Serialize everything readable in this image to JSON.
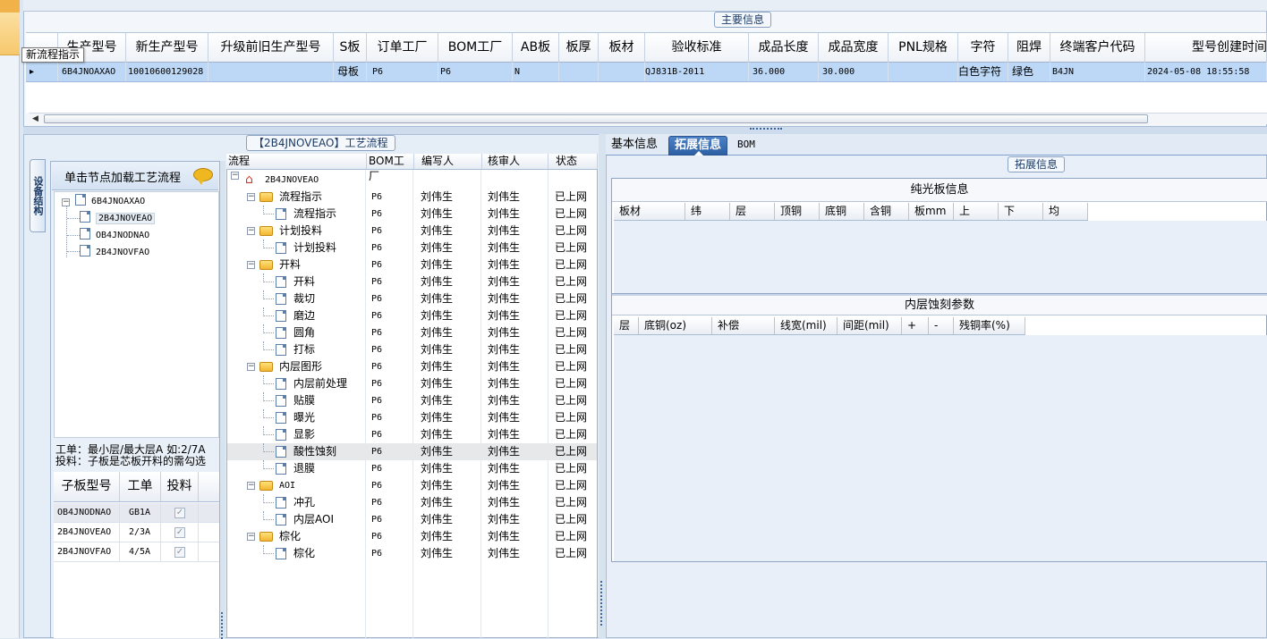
{
  "main": {
    "caption": "主要信息",
    "tooltip": "新流程指示",
    "columns": [
      "生产型号",
      "新生产型号",
      "升级前旧生产型号",
      "S板",
      "订单工厂",
      "BOM工厂",
      "AB板",
      "板厚",
      "板材",
      "验收标准",
      "成品长度",
      "成品宽度",
      "PNL规格",
      "字符",
      "阻焊",
      "终端客户代码",
      "型号创建时间"
    ],
    "row": {
      "indicator": "▸",
      "model": "6B4JNOAXAO",
      "new_model": "10010600129028",
      "old_model": "",
      "s_board": "母板",
      "order_factory": "P6",
      "bom_factory": "P6",
      "ab_board": "N",
      "thickness": "",
      "material": "",
      "standard": "QJ831B-2011",
      "length": "36.000",
      "width": "30.000",
      "pnl": "",
      "character": "白色字符",
      "solder_mask": "绿色",
      "customer_code": "B4JN",
      "created": "2024-05-08 18:55:58"
    }
  },
  "flow": {
    "caption": "【2B4JNOVEAO】工艺流程",
    "struct_tab": "设备结构",
    "struct_hint": "单击节点加载工艺流程",
    "struct_tree": {
      "root": "6B4JNOAXAO",
      "children": [
        "2B4JNOVEAO",
        "OB4JNODNAO",
        "2B4JNOVFAO"
      ]
    },
    "note_line1": "工单：最小层/最大层A 如:2/7A",
    "note_line2": "投料：子板是芯板开料的需勾选",
    "sub_columns": [
      "子板型号",
      "工单",
      "投料"
    ],
    "sub_rows": [
      {
        "model": "OB4JNODNAO",
        "order": "GB1A",
        "check": "✓"
      },
      {
        "model": "2B4JNOVEAO",
        "order": "2/3A",
        "check": "✓"
      },
      {
        "model": "2B4JNOVFAO",
        "order": "4/5A",
        "check": "✓"
      }
    ],
    "columns": [
      "流程",
      "BOM工厂",
      "编写人",
      "核审人",
      "状态"
    ],
    "root_node": "2B4JNOVEAO",
    "rows": [
      {
        "name": "流程指示",
        "type": "folder",
        "factory": "P6",
        "writer": "刘伟生",
        "reviewer": "刘伟生",
        "status": "已上网"
      },
      {
        "name": "流程指示",
        "type": "doc",
        "factory": "P6",
        "writer": "刘伟生",
        "reviewer": "刘伟生",
        "status": "已上网"
      },
      {
        "name": "计划投料",
        "type": "folder",
        "factory": "P6",
        "writer": "刘伟生",
        "reviewer": "刘伟生",
        "status": "已上网"
      },
      {
        "name": "计划投料",
        "type": "doc",
        "factory": "P6",
        "writer": "刘伟生",
        "reviewer": "刘伟生",
        "status": "已上网"
      },
      {
        "name": "开料",
        "type": "folder",
        "factory": "P6",
        "writer": "刘伟生",
        "reviewer": "刘伟生",
        "status": "已上网"
      },
      {
        "name": "开料",
        "type": "doc",
        "factory": "P6",
        "writer": "刘伟生",
        "reviewer": "刘伟生",
        "status": "已上网"
      },
      {
        "name": "裁切",
        "type": "doc",
        "factory": "P6",
        "writer": "刘伟生",
        "reviewer": "刘伟生",
        "status": "已上网"
      },
      {
        "name": "磨边",
        "type": "doc",
        "factory": "P6",
        "writer": "刘伟生",
        "reviewer": "刘伟生",
        "status": "已上网"
      },
      {
        "name": "圆角",
        "type": "doc",
        "factory": "P6",
        "writer": "刘伟生",
        "reviewer": "刘伟生",
        "status": "已上网"
      },
      {
        "name": "打标",
        "type": "doc",
        "factory": "P6",
        "writer": "刘伟生",
        "reviewer": "刘伟生",
        "status": "已上网"
      },
      {
        "name": "内层图形",
        "type": "folder",
        "factory": "P6",
        "writer": "刘伟生",
        "reviewer": "刘伟生",
        "status": "已上网"
      },
      {
        "name": "内层前处理",
        "type": "doc",
        "factory": "P6",
        "writer": "刘伟生",
        "reviewer": "刘伟生",
        "status": "已上网"
      },
      {
        "name": "贴膜",
        "type": "doc",
        "factory": "P6",
        "writer": "刘伟生",
        "reviewer": "刘伟生",
        "status": "已上网"
      },
      {
        "name": "曝光",
        "type": "doc",
        "factory": "P6",
        "writer": "刘伟生",
        "reviewer": "刘伟生",
        "status": "已上网"
      },
      {
        "name": "显影",
        "type": "doc",
        "factory": "P6",
        "writer": "刘伟生",
        "reviewer": "刘伟生",
        "status": "已上网"
      },
      {
        "name": "酸性蚀刻",
        "type": "doc",
        "factory": "P6",
        "writer": "刘伟生",
        "reviewer": "刘伟生",
        "status": "已上网"
      },
      {
        "name": "退膜",
        "type": "doc",
        "factory": "P6",
        "writer": "刘伟生",
        "reviewer": "刘伟生",
        "status": "已上网"
      },
      {
        "name": "AOI",
        "type": "folder",
        "factory": "P6",
        "writer": "刘伟生",
        "reviewer": "刘伟生",
        "status": "已上网"
      },
      {
        "name": "冲孔",
        "type": "doc",
        "factory": "P6",
        "writer": "刘伟生",
        "reviewer": "刘伟生",
        "status": "已上网"
      },
      {
        "name": "内层AOI",
        "type": "doc",
        "factory": "P6",
        "writer": "刘伟生",
        "reviewer": "刘伟生",
        "status": "已上网"
      },
      {
        "name": "棕化",
        "type": "folder",
        "factory": "P6",
        "writer": "刘伟生",
        "reviewer": "刘伟生",
        "status": "已上网"
      },
      {
        "name": "棕化",
        "type": "doc",
        "factory": "P6",
        "writer": "刘伟生",
        "reviewer": "刘伟生",
        "status": "已上网"
      }
    ]
  },
  "detail": {
    "tabs": [
      "基本信息",
      "拓展信息",
      "BOM"
    ],
    "caption": "拓展信息",
    "section1_title": "纯光板信息",
    "section1_columns": [
      "板材",
      "纬",
      "层",
      "顶铜",
      "底铜",
      "含铜",
      "板mm",
      "上",
      "下",
      "均"
    ],
    "section2_title": "内层蚀刻参数",
    "section2_columns": [
      "层",
      "底铜(oz)",
      "补偿",
      "线宽(mil)",
      "间距(mil)",
      "+",
      "-",
      "残铜率(%)"
    ]
  },
  "colors": {
    "selected_row": "#bcd8f6",
    "active_tab": "#2d5fa4",
    "panel_bg": "#e8eff8"
  }
}
